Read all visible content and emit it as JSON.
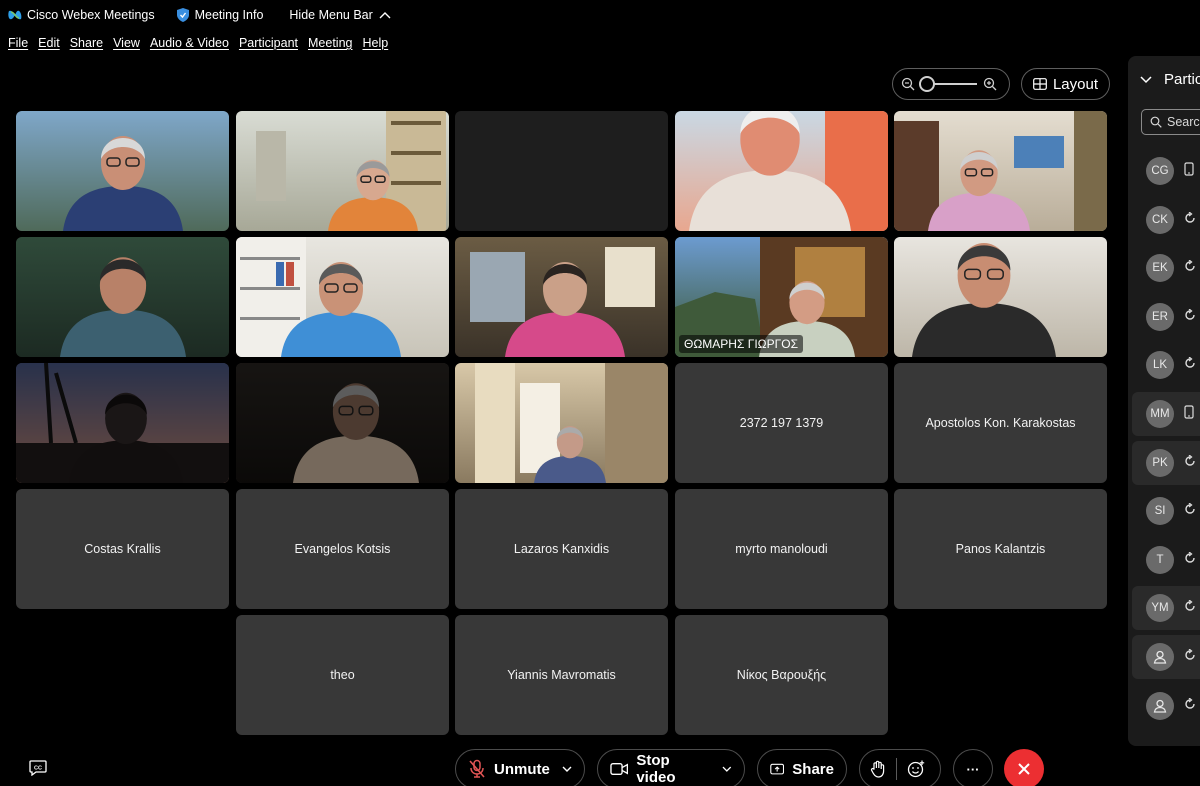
{
  "titlebar": {
    "app_name": "Cisco Webex Meetings",
    "meeting_info": "Meeting Info",
    "hide_menu": "Hide Menu Bar"
  },
  "menu": [
    "File",
    "Edit",
    "Share",
    "View",
    "Audio & Video",
    "Participant",
    "Meeting",
    "Help"
  ],
  "view": {
    "layout_label": "Layout"
  },
  "tiles": [
    {
      "type": "video",
      "scene": "outdoor-sky"
    },
    {
      "type": "video",
      "scene": "office-room"
    },
    {
      "type": "empty"
    },
    {
      "type": "video",
      "scene": "closeup"
    },
    {
      "type": "video",
      "scene": "living-room"
    },
    {
      "type": "video",
      "scene": "dark-green"
    },
    {
      "type": "video",
      "scene": "bookshelf"
    },
    {
      "type": "video",
      "scene": "window-office"
    },
    {
      "type": "video",
      "scene": "landscape",
      "label": "ΘΩΜΑΡΗΣ ΓΙΩΡΓΟΣ",
      "active": true
    },
    {
      "type": "video",
      "scene": "white-wall"
    },
    {
      "type": "video",
      "scene": "dusk"
    },
    {
      "type": "video",
      "scene": "dark-room"
    },
    {
      "type": "video",
      "scene": "curtain"
    },
    {
      "type": "name",
      "name": "2372 197 1379"
    },
    {
      "type": "name",
      "name": "Apostolos Kon. Karakostas"
    },
    {
      "type": "name",
      "name": "Costas Krallis"
    },
    {
      "type": "name",
      "name": "Evangelos Kotsis"
    },
    {
      "type": "name",
      "name": "Lazaros Kanxidis"
    },
    {
      "type": "name",
      "name": "myrto manoloudi"
    },
    {
      "type": "name",
      "name": "Panos Kalantzis"
    },
    {
      "type": "name",
      "name": "theo"
    },
    {
      "type": "name",
      "name": "Yiannis Mavromatis"
    },
    {
      "type": "name",
      "name": "Νίκος Βαρουξής"
    }
  ],
  "panel": {
    "title": "Partic",
    "search_placeholder": "Searc",
    "participants": [
      {
        "initials": "CG",
        "status": "phone"
      },
      {
        "initials": "CK",
        "status": "sync"
      },
      {
        "initials": "EK",
        "status": "sync"
      },
      {
        "initials": "ER",
        "status": "sync"
      },
      {
        "initials": "LK",
        "status": "sync"
      },
      {
        "initials": "MM",
        "status": "phone",
        "highlight": true
      },
      {
        "initials": "PK",
        "status": "sync",
        "highlight": true
      },
      {
        "initials": "SI",
        "status": "sync"
      },
      {
        "initials": "T",
        "status": "sync"
      },
      {
        "initials": "YM",
        "status": "sync",
        "highlight": true
      },
      {
        "initials": "",
        "status": "sync",
        "highlight": true,
        "icon": "person"
      },
      {
        "initials": "",
        "status": "sync",
        "icon": "person"
      }
    ]
  },
  "toolbar": {
    "unmute": "Unmute",
    "stop_video": "Stop video",
    "share": "Share",
    "more": "···"
  },
  "colors": {
    "end_button": "#ec2f32",
    "active_border": "#5bb1f0",
    "tile_bg": "#383838"
  }
}
